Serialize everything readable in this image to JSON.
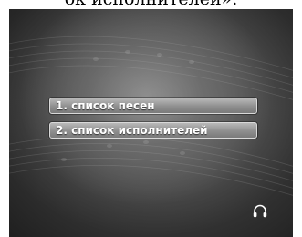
{
  "page": {
    "top_caption": "ок исполнителей»."
  },
  "menu": {
    "items": [
      {
        "label": "1. список песен"
      },
      {
        "label": "2. список исполнителей"
      }
    ]
  },
  "icons": {
    "status": "headphones-icon"
  }
}
